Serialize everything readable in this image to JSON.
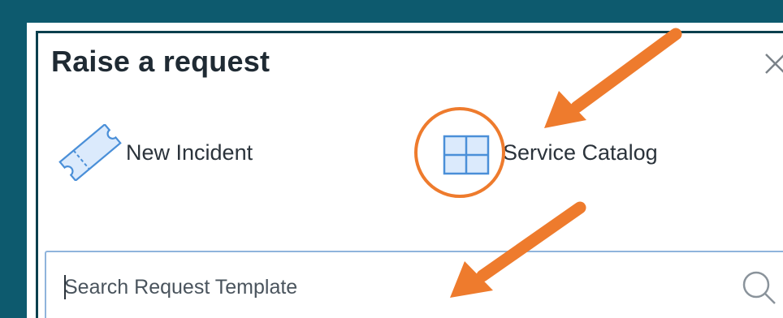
{
  "dialog": {
    "title": "Raise a request",
    "close_icon": "close-icon"
  },
  "options": [
    {
      "label": "New Incident",
      "icon": "ticket-icon"
    },
    {
      "label": "Service Catalog",
      "icon": "grid-icon"
    }
  ],
  "search": {
    "placeholder": "Search Request Template",
    "icon": "search-icon"
  },
  "annotations": {
    "arrow_color": "#ee7b2d",
    "highlight_circle_color": "#ee7b2d"
  },
  "colors": {
    "frame": "#0d5a6e",
    "accent_blue": "#4a8fd8",
    "search_border": "#8fb4dc"
  }
}
